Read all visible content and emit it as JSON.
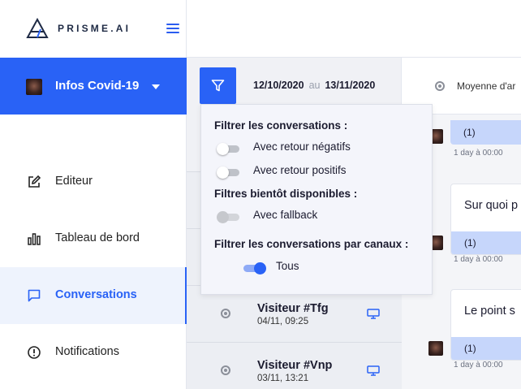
{
  "brand": {
    "name": "PRISME.AI"
  },
  "bot": {
    "name": "Infos Covid-19"
  },
  "nav": [
    {
      "label": "Editeur",
      "icon": "edit-icon"
    },
    {
      "label": "Tableau de bord",
      "icon": "bar-chart-icon"
    },
    {
      "label": "Conversations",
      "icon": "chat-bubble-icon",
      "active": true
    },
    {
      "label": "Notifications",
      "icon": "alert-circle-icon"
    }
  ],
  "dates": {
    "from": "12/10/2020",
    "separator": "au",
    "to": "13/11/2020"
  },
  "filters": {
    "title": "Filtrer les conversations :",
    "negative_label": "Avec retour négatifs",
    "positive_label": "Avec retour positifs",
    "soon_title": "Filtres bientôt disponibles :",
    "fallback_label": "Avec fallback",
    "channels_title": "Filtrer les conversations par canaux :",
    "all_label": "Tous",
    "negative_on": false,
    "positive_on": false,
    "fallback_on": false,
    "all_on": true
  },
  "conversations": [
    {
      "name": "Visiteur #Tfg",
      "when": "04/11, 09:25",
      "channel_icon": "monitor-icon"
    },
    {
      "name": "Visiteur #Vnp",
      "when": "03/11, 13:21",
      "channel_icon": "monitor-icon"
    }
  ],
  "detail": {
    "header": "Moyenne d'ar",
    "messages": [
      {
        "question": "",
        "answer": "(1)",
        "time": "1 day à 00:00"
      },
      {
        "question": "Sur quoi p",
        "answer": "(1)",
        "time": "1 day à 00:00"
      },
      {
        "question": "Le point s",
        "answer": "(1)",
        "time": "1 day à 00:00"
      }
    ]
  },
  "colors": {
    "accent": "#2962f6",
    "answer_bg": "#c6d6fb",
    "list_bg": "#f0f1f5"
  }
}
